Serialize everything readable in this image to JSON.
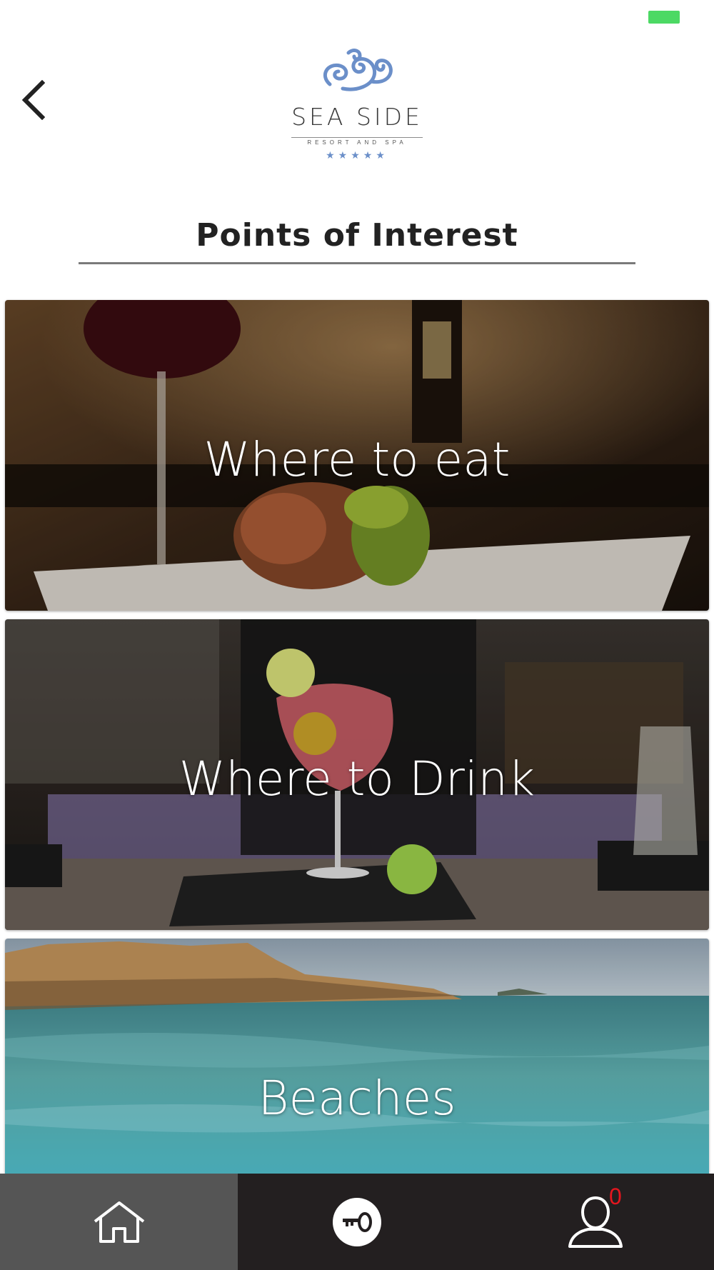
{
  "header": {
    "logo": {
      "name": "SEA SIDE",
      "subtitle": "RESORT AND SPA",
      "stars": "★★★★★"
    },
    "back_icon": "chevron-left-icon"
  },
  "page": {
    "title": "Points of Interest"
  },
  "cards": [
    {
      "label": "Where to eat"
    },
    {
      "label": "Where to Drink"
    },
    {
      "label": "Beaches"
    }
  ],
  "bottom_nav": {
    "home_icon": "home-icon",
    "key_icon": "key-icon",
    "profile_icon": "user-icon",
    "profile_badge": "0"
  },
  "colors": {
    "battery": "#4cd964",
    "nav_bg": "#231f20",
    "nav_active": "#555555",
    "badge": "#e5161e",
    "logo_blue": "#6b8fc9"
  }
}
